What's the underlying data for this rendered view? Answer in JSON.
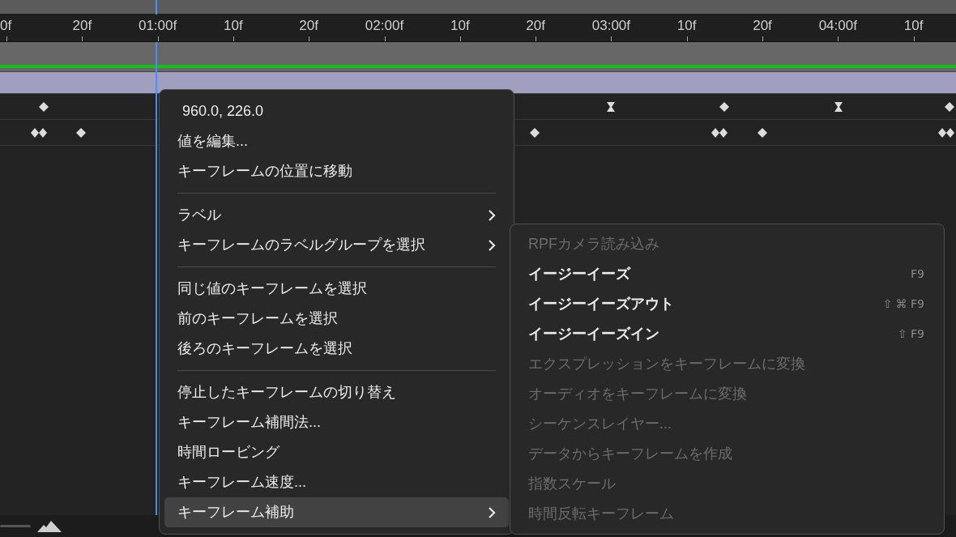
{
  "ruler": {
    "labels": [
      "0f",
      "20f",
      "01:00f",
      "10f",
      "20f",
      "02:00f",
      "10f",
      "20f",
      "03:00f",
      "10f",
      "20f",
      "04:00f",
      "10f"
    ]
  },
  "context_menu": {
    "items": [
      {
        "kind": "value",
        "label": "960.0, 226.0",
        "selected": false
      },
      {
        "kind": "item",
        "label": "値を編集...",
        "selected": false
      },
      {
        "kind": "item",
        "label": "キーフレームの位置に移動",
        "selected": false
      },
      {
        "kind": "separator"
      },
      {
        "kind": "submenu",
        "label": "ラベル",
        "selected": false
      },
      {
        "kind": "submenu",
        "label": "キーフレームのラベルグループを選択",
        "selected": false
      },
      {
        "kind": "separator"
      },
      {
        "kind": "item",
        "label": "同じ値のキーフレームを選択",
        "selected": false
      },
      {
        "kind": "item",
        "label": "前のキーフレームを選択",
        "selected": false
      },
      {
        "kind": "item",
        "label": "後ろのキーフレームを選択",
        "selected": false
      },
      {
        "kind": "separator"
      },
      {
        "kind": "item",
        "label": "停止したキーフレームの切り替え",
        "selected": false
      },
      {
        "kind": "item",
        "label": "キーフレーム補間法...",
        "selected": false
      },
      {
        "kind": "item",
        "label": "時間ロービング",
        "selected": false
      },
      {
        "kind": "item",
        "label": "キーフレーム速度...",
        "selected": false
      },
      {
        "kind": "submenu",
        "label": "キーフレーム補助",
        "selected": true
      }
    ]
  },
  "submenu": {
    "items": [
      {
        "label": "RPFカメラ読み込み",
        "disabled": true
      },
      {
        "label": "イージーイーズ",
        "disabled": false,
        "shortcut": "F9"
      },
      {
        "label": "イージーイーズアウト",
        "disabled": false,
        "shortcut": "⇧ ⌘ F9"
      },
      {
        "label": "イージーイーズイン",
        "disabled": false,
        "shortcut": "⇧ F9"
      },
      {
        "label": "エクスプレッションをキーフレームに変換",
        "disabled": true
      },
      {
        "label": "オーディオをキーフレームに変換",
        "disabled": true
      },
      {
        "label": "シーケンスレイヤー...",
        "disabled": true
      },
      {
        "label": "データからキーフレームを作成",
        "disabled": true
      },
      {
        "label": "指数スケール",
        "disabled": true
      },
      {
        "label": "時間反転キーフレーム",
        "disabled": true
      }
    ]
  }
}
